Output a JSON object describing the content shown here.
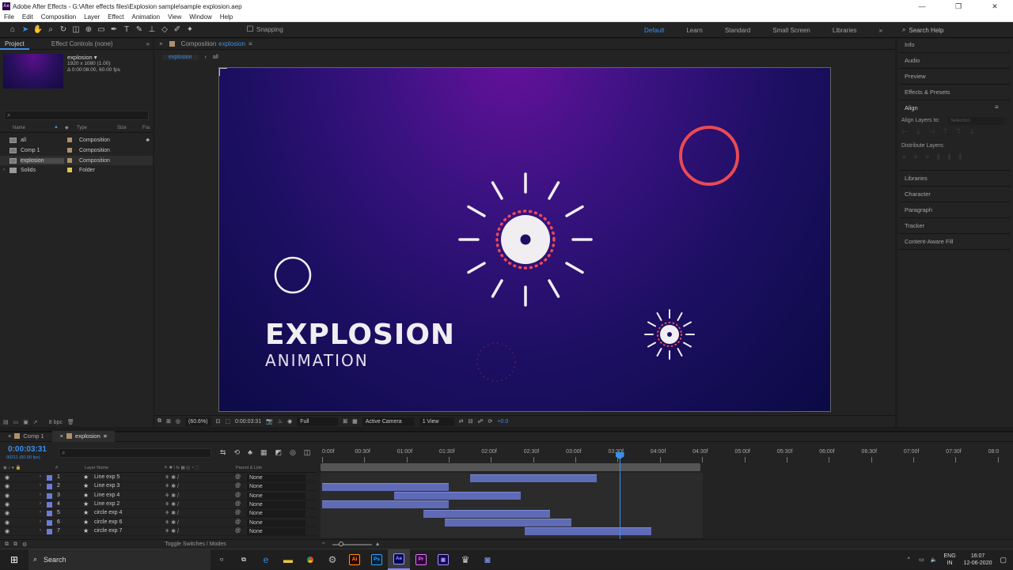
{
  "window": {
    "title": "Adobe After Effects - G:\\After effects files\\Explosion sample\\sample explosion.aep",
    "controls": [
      "—",
      "❐",
      "✕"
    ]
  },
  "menu": [
    "File",
    "Edit",
    "Composition",
    "Layer",
    "Effect",
    "Animation",
    "View",
    "Window",
    "Help"
  ],
  "toolbar": {
    "snapping_label": "Snapping",
    "workspaces": [
      "Default",
      "Learn",
      "Standard",
      "Small Screen",
      "Libraries"
    ],
    "active_workspace": "Default",
    "search_placeholder": "Search Help"
  },
  "project": {
    "tab_project": "Project",
    "tab_effect_controls": "Effect Controls (none)",
    "selected_name": "explosion ▾",
    "selected_dims": "1920 x 1080 (1.00)",
    "selected_duration": "Δ 0:00:08:00, 60.00 fps",
    "columns": {
      "name": "Name",
      "type": "Type",
      "size": "Size",
      "frame": "Fra"
    },
    "items": [
      {
        "name": "all",
        "type": "Composition",
        "label_color": "#b0906a"
      },
      {
        "name": "Comp 1",
        "type": "Composition",
        "label_color": "#b0906a"
      },
      {
        "name": "explosion",
        "type": "Composition",
        "label_color": "#b0906a"
      },
      {
        "name": "Solids",
        "type": "Folder",
        "label_color": "#e3c64b"
      }
    ],
    "bpc": "8 bpc"
  },
  "composition": {
    "header_prefix": "Composition",
    "header_name": "explosion",
    "breadcrumbs": [
      "explosion",
      "all"
    ],
    "title_big": "EXPLOSION",
    "title_small": "ANIMATION",
    "footer": {
      "zoom": "(60.6%)",
      "timecode": "0:00:03:31",
      "resolution": "Full",
      "camera": "Active Camera",
      "view": "1 View",
      "exposure": "+0.0"
    },
    "colors": {
      "accent_red": "#e94a55",
      "white": "#f1eef2"
    }
  },
  "right_panel": {
    "items": [
      "Info",
      "Audio",
      "Preview",
      "Effects & Presets",
      "Align"
    ],
    "align_layers_to": "Align Layers to:",
    "selection": "Selection",
    "distribute_layers": "Distribute Layers:",
    "more_items": [
      "Libraries",
      "Character",
      "Paragraph",
      "Tracker",
      "Content-Aware Fill"
    ]
  },
  "timeline": {
    "tabs": [
      "Comp 1",
      "explosion"
    ],
    "timecode": "0:00:03:31",
    "fps_line": "00211 (60.00 fps)",
    "columns": {
      "source": "Layer Name",
      "parent": "Parent & Link"
    },
    "ruler": [
      "0:00f",
      "00:30f",
      "01:00f",
      "01:30f",
      "02:00f",
      "02:30f",
      "03:00f",
      "03:30f",
      "04:00f",
      "04:30f",
      "05:00f",
      "05:30f",
      "06:00f",
      "06:30f",
      "07:00f",
      "07:30f",
      "08:0"
    ],
    "duration_seconds": 8,
    "current_time_seconds": 3.52,
    "work_area_end_seconds": 4.5,
    "layers": [
      {
        "num": "1",
        "name": "Line exp 5",
        "parent": "None",
        "in": 1.75,
        "out": 3.25
      },
      {
        "num": "2",
        "name": "Line exp 3",
        "parent": "None",
        "in": 0.0,
        "out": 1.5
      },
      {
        "num": "3",
        "name": "Line exp 4",
        "parent": "None",
        "in": 0.85,
        "out": 2.35
      },
      {
        "num": "4",
        "name": "Line exp 2",
        "parent": "None",
        "in": 0.0,
        "out": 1.5
      },
      {
        "num": "5",
        "name": "circle exp 4",
        "parent": "None",
        "in": 1.2,
        "out": 2.7
      },
      {
        "num": "6",
        "name": "circle exp 6",
        "parent": "None",
        "in": 1.45,
        "out": 2.95
      },
      {
        "num": "7",
        "name": "circle exp 7",
        "parent": "None",
        "in": 2.4,
        "out": 3.9
      }
    ],
    "toggle_label": "Toggle Switches / Modes"
  },
  "taskbar": {
    "search": "Search",
    "apps": [
      "Ai",
      "Ps",
      "Ae",
      "Pr"
    ],
    "lang_top": "ENG",
    "lang_bottom": "IN",
    "time": "16:07",
    "date": "12-06-2020"
  }
}
